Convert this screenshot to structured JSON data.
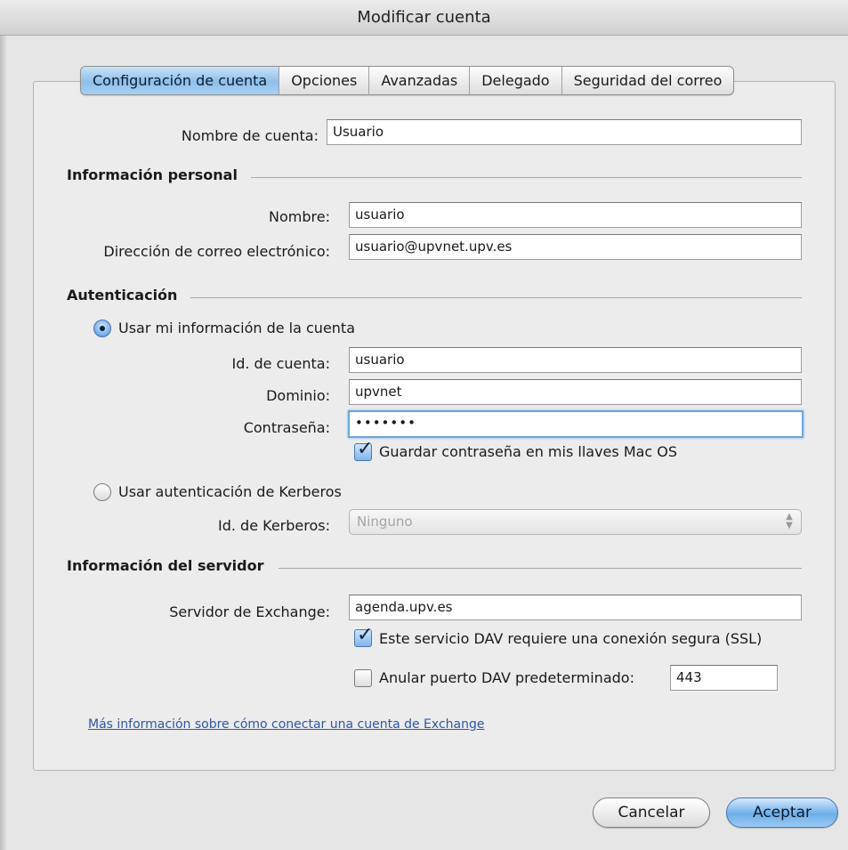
{
  "window": {
    "title": "Modificar cuenta"
  },
  "tabs": [
    {
      "label": "Configuración de cuenta",
      "active": true
    },
    {
      "label": "Opciones",
      "active": false
    },
    {
      "label": "Avanzadas",
      "active": false
    },
    {
      "label": "Delegado",
      "active": false
    },
    {
      "label": "Seguridad del correo",
      "active": false
    }
  ],
  "account": {
    "name_label": "Nombre de cuenta:",
    "name_value": "Usuario"
  },
  "personal": {
    "heading": "Información personal",
    "name_label": "Nombre:",
    "name_value": "usuario",
    "email_label": "Dirección de correo electrónico:",
    "email_value": "usuario@upvnet.upv.es"
  },
  "auth": {
    "heading": "Autenticación",
    "use_account_label": "Usar mi información de la cuenta",
    "use_account_selected": true,
    "account_id_label": "Id. de cuenta:",
    "account_id_value": "usuario",
    "domain_label": "Dominio:",
    "domain_value": "upvnet",
    "password_label": "Contraseña:",
    "password_value": "•••••••",
    "save_password_label": "Guardar contraseña en mis llaves Mac OS",
    "save_password_checked": true,
    "kerberos_label": "Usar autenticación de Kerberos",
    "kerberos_selected": false,
    "kerberos_id_label": "Id. de Kerberos:",
    "kerberos_id_value": "Ninguno"
  },
  "server": {
    "heading": "Información del servidor",
    "exchange_label": "Servidor de Exchange:",
    "exchange_value": "agenda.upv.es",
    "ssl_label": "Este servicio DAV requiere una conexión segura (SSL)",
    "ssl_checked": true,
    "override_port_label": "Anular puerto DAV predeterminado:",
    "override_port_checked": false,
    "port_value": "443"
  },
  "help_link": "Más información sobre cómo conectar una cuenta de Exchange",
  "buttons": {
    "cancel": "Cancelar",
    "accept": "Aceptar"
  },
  "colors": {
    "accent": "#8ebfea",
    "link": "#2e57a8",
    "focus_ring": "#6ca4e0"
  }
}
